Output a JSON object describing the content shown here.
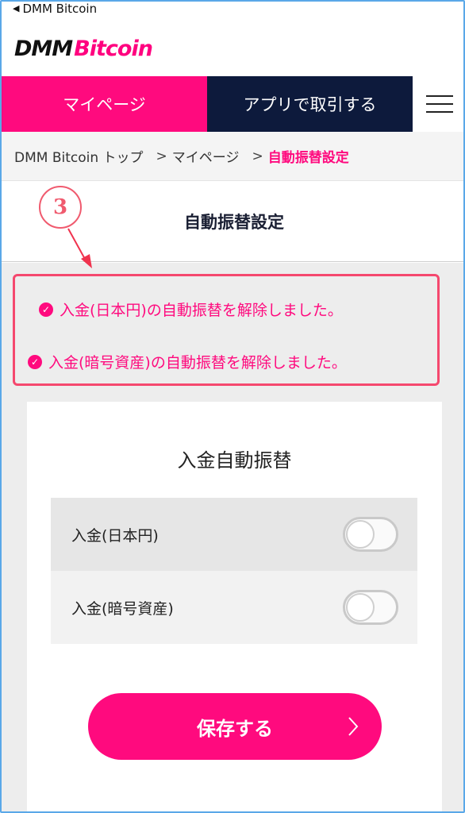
{
  "status_bar": {
    "back_label": "DMM Bitcoin"
  },
  "logo": {
    "part1": "DMM",
    "part2": "Bitcoin"
  },
  "nav": {
    "mypage": "マイページ",
    "app_trade": "アプリで取引する",
    "menu_icon": "hamburger-menu-icon"
  },
  "breadcrumb": {
    "items": [
      "DMM Bitcoin トップ",
      "マイページ",
      "自動振替設定"
    ],
    "separator": ">"
  },
  "page": {
    "title": "自動振替設定"
  },
  "annotation": {
    "step": "3",
    "color": "#f05a6e"
  },
  "messages": [
    "入金(日本円)の自動振替を解除しました。",
    "入金(暗号資産)の自動振替を解除しました。"
  ],
  "card": {
    "title": "入金自動振替",
    "rows": [
      {
        "label": "入金(日本円)",
        "enabled": false
      },
      {
        "label": "入金(暗号資産)",
        "enabled": false
      }
    ],
    "save_label": "保存する"
  },
  "colors": {
    "brand_pink": "#ff0a7e",
    "navy": "#0d1a3c",
    "annotation_red": "#f5486e"
  }
}
